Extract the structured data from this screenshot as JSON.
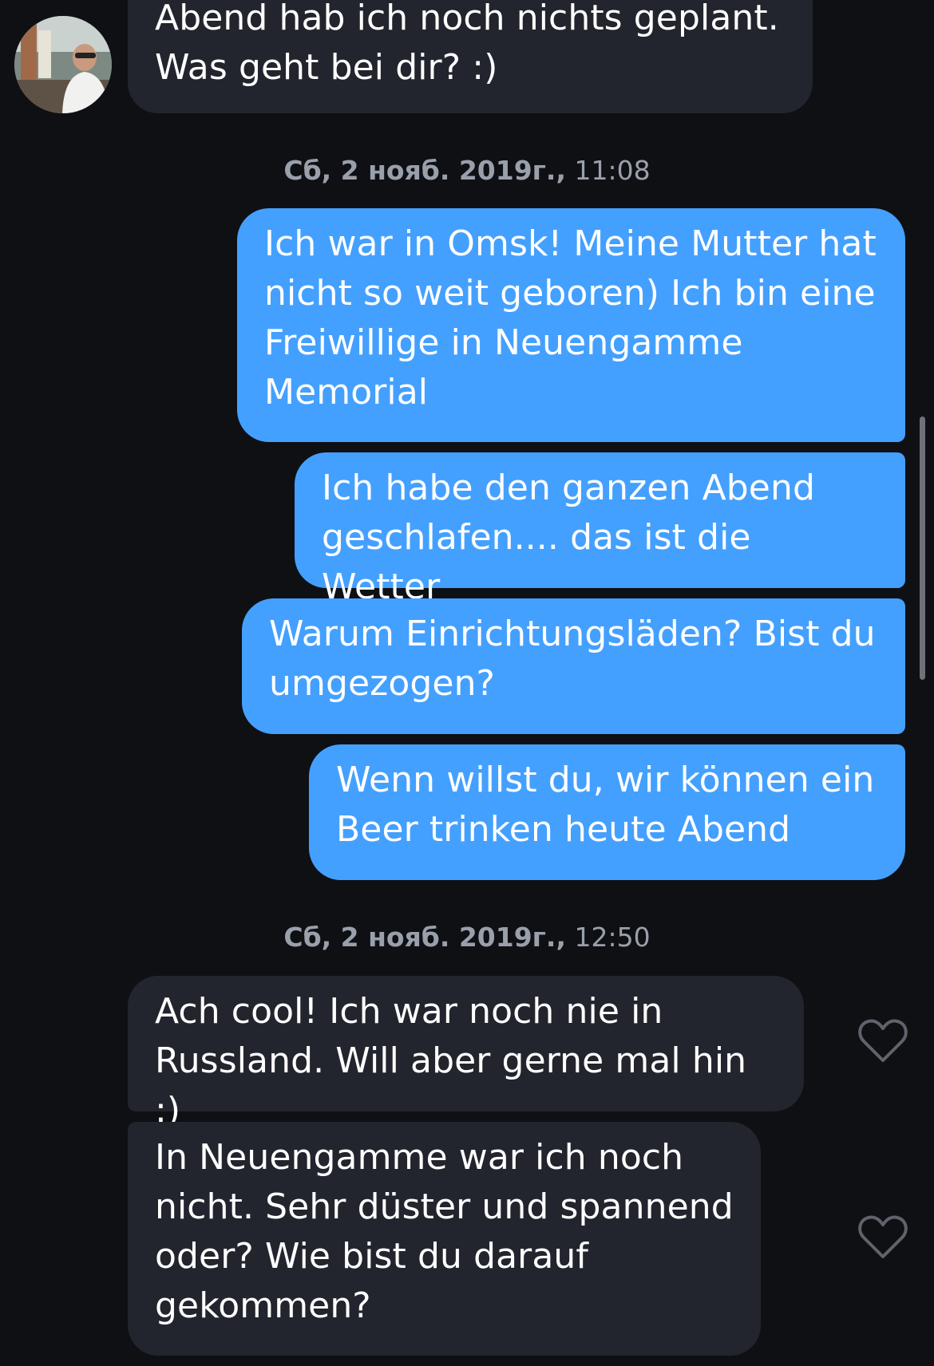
{
  "avatar_icon": "user-avatar-photo",
  "heart_icon": "heart-outline-icon",
  "colors": {
    "background": "#0f1014",
    "incoming_bubble": "#22252d",
    "outgoing_bubble": "#44a0ff",
    "timestamp_text": "#9aa0ab"
  },
  "messages": {
    "incoming_1": "Abend hab ich noch nichts geplant.\nWas geht bei dir? :)",
    "outgoing_1": "Ich war in Omsk! Meine Mutter hat\nnicht so weit geboren) Ich bin eine\nFreiwillige in Neuengamme\nMemorial",
    "outgoing_2": "Ich habe den ganzen Abend\ngeschlafen.... das ist die Wetter",
    "outgoing_3": "Warum Einrichtungsläden? Bist du\numgezogen?",
    "outgoing_4": "Wenn willst du, wir können ein\nBeer trinken heute Abend",
    "incoming_2": "Ach cool! Ich war noch nie in\nRussland. Will aber gerne mal hin :)",
    "incoming_3": "In Neuengamme war ich noch\nnicht. Sehr düster und spannend\noder? Wie bist du darauf\ngekommen?"
  },
  "timestamps": {
    "ts1_date": "Сб, 2 нояб. 2019г.,",
    "ts1_time": "11:08",
    "ts2_date": "Сб, 2 нояб. 2019г.,",
    "ts2_time": "12:50"
  }
}
